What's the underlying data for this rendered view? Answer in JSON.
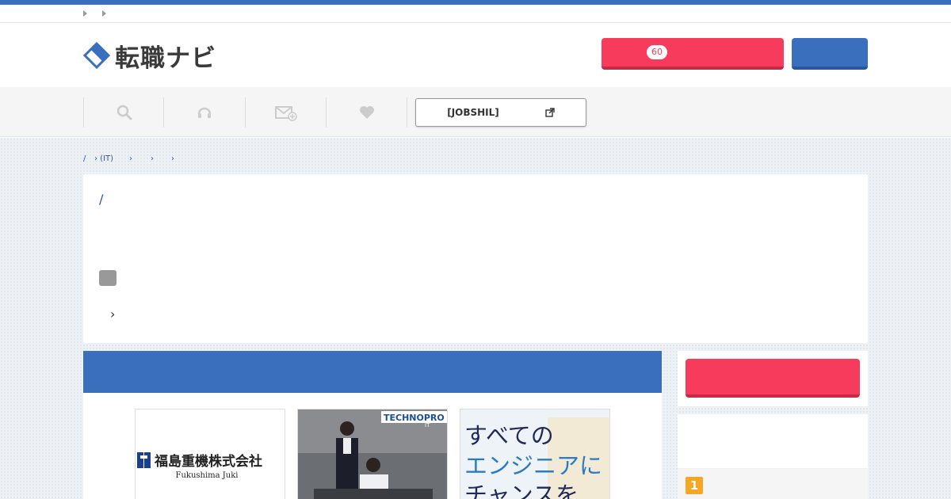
{
  "header": {
    "logo_text": "転職ナビ",
    "login_badge_count": "60"
  },
  "nav": {
    "external_label": "[JOBSHIL]"
  },
  "breadcrumb": {
    "items": [
      "/",
      "› (IT)",
      "›",
      "›",
      "›"
    ]
  },
  "card_top": {
    "slash": "/",
    "chevron": "›"
  },
  "thumbnails": [
    {
      "company_jp": "福島重機株式会社",
      "company_en": "Fukushima Juki"
    },
    {
      "company_en": "TECHNOPRO",
      "sub": "IT"
    },
    {
      "line1": "すべての",
      "line2": "エンジニアに",
      "line3": "チャンスを"
    }
  ],
  "sidebar": {
    "rank_number": "1"
  },
  "colors": {
    "brand_blue": "#3a6fbd",
    "accent_red": "#f63b5d",
    "rank_orange": "#f5a623"
  }
}
